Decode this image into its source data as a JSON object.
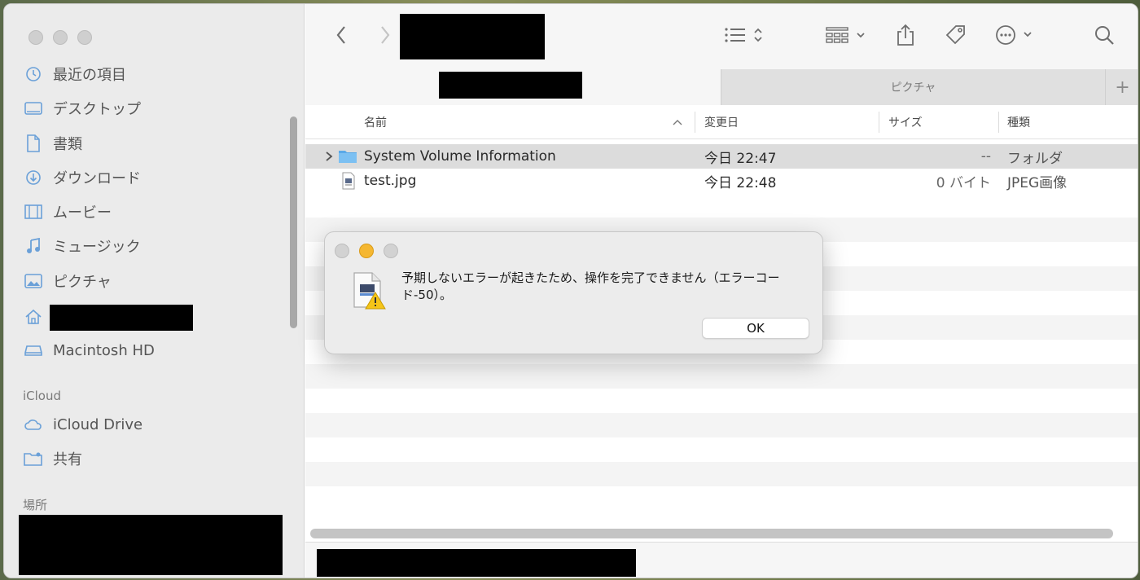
{
  "sidebar": {
    "items": [
      {
        "label": "最近の項目",
        "icon": "clock-icon"
      },
      {
        "label": "デスクトップ",
        "icon": "desktop-icon"
      },
      {
        "label": "書類",
        "icon": "document-icon"
      },
      {
        "label": "ダウンロード",
        "icon": "download-icon"
      },
      {
        "label": "ムービー",
        "icon": "film-icon"
      },
      {
        "label": "ミュージック",
        "icon": "music-note-icon"
      },
      {
        "label": "ピクチャ",
        "icon": "photo-icon"
      },
      {
        "label": "",
        "icon": "home-icon"
      },
      {
        "label": "Macintosh HD",
        "icon": "disk-icon"
      }
    ],
    "icloud_section": "iCloud",
    "icloud_items": [
      {
        "label": "iCloud Drive",
        "icon": "cloud-icon"
      },
      {
        "label": "共有",
        "icon": "shared-folder-icon"
      }
    ],
    "locations_section": "場所"
  },
  "tabs": {
    "inactive_label": "ピクチャ",
    "plus_label": "+"
  },
  "columns": {
    "name": "名前",
    "modified": "変更日",
    "size": "サイズ",
    "kind": "種類"
  },
  "files": [
    {
      "name": "System Volume Information",
      "modified": "今日 22:47",
      "size": "--",
      "kind": "フォルダ",
      "icon": "folder-icon"
    },
    {
      "name": "test.jpg",
      "modified": "今日 22:48",
      "size": "0 バイト",
      "kind": "JPEG画像",
      "icon": "jpeg-file-icon"
    }
  ],
  "dialog": {
    "message": "予期しないエラーが起きたため、操作を完了できません（エラーコード-50）。",
    "ok_label": "OK",
    "icon": "jpeg-warning-icon"
  },
  "colors": {
    "accent": "#6aa0d8",
    "minimize": "#f5b731",
    "folder": "#5aa9e8"
  }
}
